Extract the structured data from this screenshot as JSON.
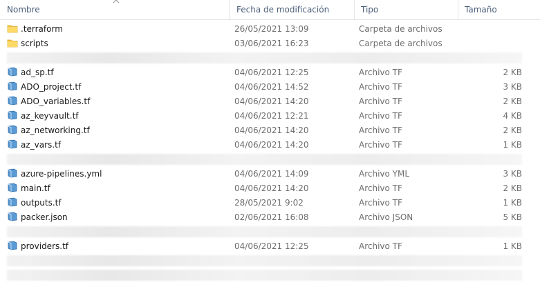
{
  "columns": {
    "name": "Nombre",
    "date": "Fecha de modificación",
    "type": "Tipo",
    "size": "Tamaño"
  },
  "sort_icon": "chevron-up-icon",
  "rows": [
    {
      "kind": "folder",
      "name": ".terraform",
      "date": "26/05/2021 13:09",
      "type": "Carpeta de archivos",
      "size": ""
    },
    {
      "kind": "folder",
      "name": "scripts",
      "date": "03/06/2021 16:23",
      "type": "Carpeta de archivos",
      "size": ""
    },
    {
      "kind": "redacted"
    },
    {
      "kind": "file",
      "name": "ad_sp.tf",
      "date": "04/06/2021 12:25",
      "type": "Archivo TF",
      "size": "2 KB"
    },
    {
      "kind": "file",
      "name": "ADO_project.tf",
      "date": "04/06/2021 14:52",
      "type": "Archivo TF",
      "size": "3 KB"
    },
    {
      "kind": "file",
      "name": "ADO_variables.tf",
      "date": "04/06/2021 14:20",
      "type": "Archivo TF",
      "size": "2 KB"
    },
    {
      "kind": "file",
      "name": "az_keyvault.tf",
      "date": "04/06/2021 12:21",
      "type": "Archivo TF",
      "size": "4 KB"
    },
    {
      "kind": "file",
      "name": "az_networking.tf",
      "date": "04/06/2021 14:20",
      "type": "Archivo TF",
      "size": "2 KB"
    },
    {
      "kind": "file",
      "name": "az_vars.tf",
      "date": "04/06/2021 14:20",
      "type": "Archivo TF",
      "size": "1 KB"
    },
    {
      "kind": "redacted"
    },
    {
      "kind": "file",
      "name": "azure-pipelines.yml",
      "date": "04/06/2021 14:09",
      "type": "Archivo YML",
      "size": "3 KB"
    },
    {
      "kind": "file",
      "name": "main.tf",
      "date": "04/06/2021 14:20",
      "type": "Archivo TF",
      "size": "2 KB"
    },
    {
      "kind": "file",
      "name": "outputs.tf",
      "date": "28/05/2021 9:02",
      "type": "Archivo TF",
      "size": "1 KB"
    },
    {
      "kind": "file",
      "name": "packer.json",
      "date": "02/06/2021 16:08",
      "type": "Archivo JSON",
      "size": "5 KB"
    },
    {
      "kind": "redacted"
    },
    {
      "kind": "file",
      "name": "providers.tf",
      "date": "04/06/2021 12:25",
      "type": "Archivo TF",
      "size": "1 KB"
    },
    {
      "kind": "redacted"
    },
    {
      "kind": "redacted"
    }
  ],
  "colors": {
    "header_text": "#4c607a",
    "folder": "#f0c040",
    "file_icon": "#4a8fc8"
  }
}
